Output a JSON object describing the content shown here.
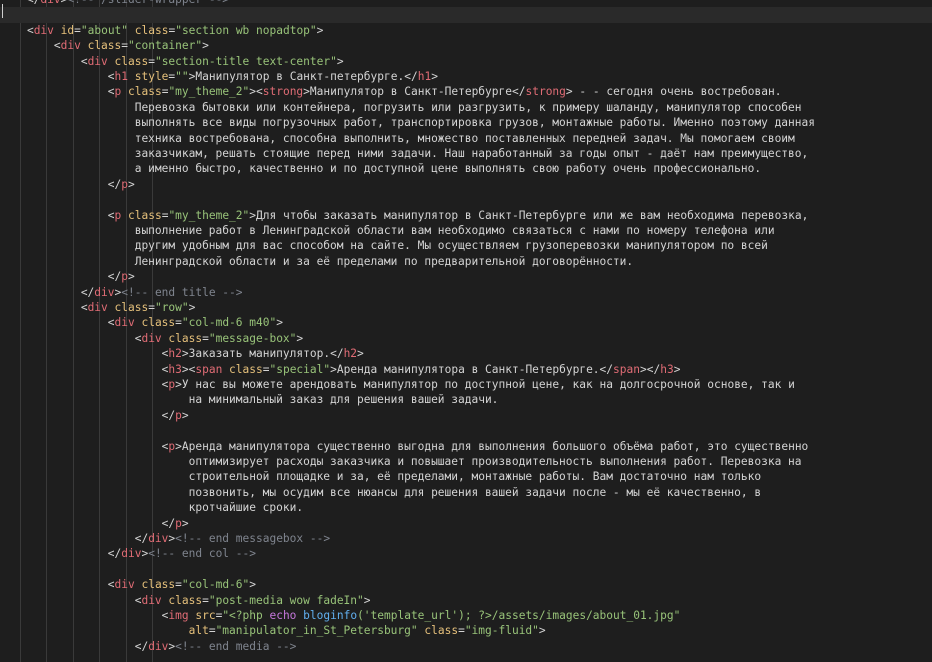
{
  "lines": [
    [
      {
        "cls": "p",
        "text": "    </"
      },
      {
        "cls": "t",
        "text": "div"
      },
      {
        "cls": "p",
        "text": ">"
      },
      {
        "cls": "c",
        "text": "<!-- /slider-wrapper -->"
      }
    ],
    [],
    [
      {
        "cls": "p",
        "text": "    <"
      },
      {
        "cls": "t",
        "text": "div"
      },
      {
        "cls": "a",
        "text": " id"
      },
      {
        "cls": "p",
        "text": "="
      },
      {
        "cls": "s",
        "text": "\"about\""
      },
      {
        "cls": "a",
        "text": " class"
      },
      {
        "cls": "p",
        "text": "="
      },
      {
        "cls": "s",
        "text": "\"section wb nopadtop\""
      },
      {
        "cls": "p",
        "text": ">"
      }
    ],
    [
      {
        "cls": "p",
        "text": "        <"
      },
      {
        "cls": "t",
        "text": "div"
      },
      {
        "cls": "a",
        "text": " class"
      },
      {
        "cls": "p",
        "text": "="
      },
      {
        "cls": "s",
        "text": "\"container\""
      },
      {
        "cls": "p",
        "text": ">"
      }
    ],
    [
      {
        "cls": "p",
        "text": "            <"
      },
      {
        "cls": "t",
        "text": "div"
      },
      {
        "cls": "a",
        "text": " class"
      },
      {
        "cls": "p",
        "text": "="
      },
      {
        "cls": "s",
        "text": "\"section-title text-center\""
      },
      {
        "cls": "p",
        "text": ">"
      }
    ],
    [
      {
        "cls": "p",
        "text": "                <"
      },
      {
        "cls": "t",
        "text": "h1"
      },
      {
        "cls": "a",
        "text": " style"
      },
      {
        "cls": "p",
        "text": "="
      },
      {
        "cls": "s",
        "text": "\"\""
      },
      {
        "cls": "p",
        "text": ">"
      },
      {
        "cls": "x",
        "text": "Манипулятор в Санкт-петербурге."
      },
      {
        "cls": "p",
        "text": "</"
      },
      {
        "cls": "t",
        "text": "h1"
      },
      {
        "cls": "p",
        "text": ">"
      }
    ],
    [
      {
        "cls": "p",
        "text": "                <"
      },
      {
        "cls": "t",
        "text": "p"
      },
      {
        "cls": "a",
        "text": " class"
      },
      {
        "cls": "p",
        "text": "="
      },
      {
        "cls": "s",
        "text": "\"my_theme_2\""
      },
      {
        "cls": "p",
        "text": "><"
      },
      {
        "cls": "t",
        "text": "strong"
      },
      {
        "cls": "p",
        "text": ">"
      },
      {
        "cls": "x",
        "text": "Манипулятор в Санкт-Петербурге"
      },
      {
        "cls": "p",
        "text": "</"
      },
      {
        "cls": "t",
        "text": "strong"
      },
      {
        "cls": "p",
        "text": ">"
      },
      {
        "cls": "x",
        "text": " - - сегодня очень востребован."
      }
    ],
    [
      {
        "cls": "x",
        "text": "                    Перевозка бытовки или контейнера, погрузить или разгрузить, к примеру шаланду, манипулятор способен"
      }
    ],
    [
      {
        "cls": "x",
        "text": "                    выполнять все виды погрузочных работ, транспортировка грузов, монтажные работы. Именно поэтому данная"
      }
    ],
    [
      {
        "cls": "x",
        "text": "                    техника востребована, способна выполнить, множество поставленных передней задач. Мы помогаем своим"
      }
    ],
    [
      {
        "cls": "x",
        "text": "                    заказчикам, решать стоящие перед ними задачи. Наш наработанный за годы опыт - даёт нам преимущество,"
      }
    ],
    [
      {
        "cls": "x",
        "text": "                    а именно быстро, качественно и по доступной цене выполнять свою работу очень профессионально."
      }
    ],
    [
      {
        "cls": "p",
        "text": "                </"
      },
      {
        "cls": "t",
        "text": "p"
      },
      {
        "cls": "p",
        "text": ">"
      }
    ],
    [],
    [
      {
        "cls": "p",
        "text": "                <"
      },
      {
        "cls": "t",
        "text": "p"
      },
      {
        "cls": "a",
        "text": " class"
      },
      {
        "cls": "p",
        "text": "="
      },
      {
        "cls": "s",
        "text": "\"my_theme_2\""
      },
      {
        "cls": "p",
        "text": ">"
      },
      {
        "cls": "x",
        "text": "Для чтобы заказать манипулятор в Санкт-Петербурге или же вам необходима перевозка,"
      }
    ],
    [
      {
        "cls": "x",
        "text": "                    выполнение работ в Ленинградской области вам необходимо связаться с нами по номеру телефона или"
      }
    ],
    [
      {
        "cls": "x",
        "text": "                    другим удобным для вас способом на сайте. Мы осуществляем грузоперевозки манипулятором по всей"
      }
    ],
    [
      {
        "cls": "x",
        "text": "                    Ленинградской области и за её пределами по предварительной договорённости."
      }
    ],
    [
      {
        "cls": "p",
        "text": "                </"
      },
      {
        "cls": "t",
        "text": "p"
      },
      {
        "cls": "p",
        "text": ">"
      }
    ],
    [
      {
        "cls": "p",
        "text": "            </"
      },
      {
        "cls": "t",
        "text": "div"
      },
      {
        "cls": "p",
        "text": ">"
      },
      {
        "cls": "c",
        "text": "<!-- end title -->"
      }
    ],
    [
      {
        "cls": "p",
        "text": "            <"
      },
      {
        "cls": "t",
        "text": "div"
      },
      {
        "cls": "a",
        "text": " class"
      },
      {
        "cls": "p",
        "text": "="
      },
      {
        "cls": "s",
        "text": "\"row\""
      },
      {
        "cls": "p",
        "text": ">"
      }
    ],
    [
      {
        "cls": "p",
        "text": "                <"
      },
      {
        "cls": "t",
        "text": "div"
      },
      {
        "cls": "a",
        "text": " class"
      },
      {
        "cls": "p",
        "text": "="
      },
      {
        "cls": "s",
        "text": "\"col-md-6 m40\""
      },
      {
        "cls": "p",
        "text": ">"
      }
    ],
    [
      {
        "cls": "p",
        "text": "                    <"
      },
      {
        "cls": "t",
        "text": "div"
      },
      {
        "cls": "a",
        "text": " class"
      },
      {
        "cls": "p",
        "text": "="
      },
      {
        "cls": "s",
        "text": "\"message-box\""
      },
      {
        "cls": "p",
        "text": ">"
      }
    ],
    [
      {
        "cls": "p",
        "text": "                        <"
      },
      {
        "cls": "t",
        "text": "h2"
      },
      {
        "cls": "p",
        "text": ">"
      },
      {
        "cls": "x",
        "text": "Заказать манипулятор."
      },
      {
        "cls": "p",
        "text": "</"
      },
      {
        "cls": "t",
        "text": "h2"
      },
      {
        "cls": "p",
        "text": ">"
      }
    ],
    [
      {
        "cls": "p",
        "text": "                        <"
      },
      {
        "cls": "t",
        "text": "h3"
      },
      {
        "cls": "p",
        "text": "><"
      },
      {
        "cls": "t",
        "text": "span"
      },
      {
        "cls": "a",
        "text": " class"
      },
      {
        "cls": "p",
        "text": "="
      },
      {
        "cls": "s",
        "text": "\"special\""
      },
      {
        "cls": "p",
        "text": ">"
      },
      {
        "cls": "x",
        "text": "Аренда манипулятора в Санкт-Петербурге."
      },
      {
        "cls": "p",
        "text": "</"
      },
      {
        "cls": "t",
        "text": "span"
      },
      {
        "cls": "p",
        "text": "></"
      },
      {
        "cls": "t",
        "text": "h3"
      },
      {
        "cls": "p",
        "text": ">"
      }
    ],
    [
      {
        "cls": "p",
        "text": "                        <"
      },
      {
        "cls": "t",
        "text": "p"
      },
      {
        "cls": "p",
        "text": ">"
      },
      {
        "cls": "x",
        "text": "У нас вы можете арендовать манипулятор по доступной цене, как на долгосрочной основе, так и"
      }
    ],
    [
      {
        "cls": "x",
        "text": "                            на минимальный заказ для решения вашей задачи."
      }
    ],
    [
      {
        "cls": "p",
        "text": "                        </"
      },
      {
        "cls": "t",
        "text": "p"
      },
      {
        "cls": "p",
        "text": ">"
      }
    ],
    [],
    [
      {
        "cls": "p",
        "text": "                        <"
      },
      {
        "cls": "t",
        "text": "p"
      },
      {
        "cls": "p",
        "text": ">"
      },
      {
        "cls": "x",
        "text": "Аренда манипулятора существенно выгодна для выполнения большого объёма работ, это существенно"
      }
    ],
    [
      {
        "cls": "x",
        "text": "                            оптимизирует расходы заказчика и повышает производительность выполнения работ. Перевозка на"
      }
    ],
    [
      {
        "cls": "x",
        "text": "                            строительной площадке и за, её пределами, монтажные работы. Вам достаточно нам только"
      }
    ],
    [
      {
        "cls": "x",
        "text": "                            позвонить, мы осудим все нюансы для решения вашей задачи после - мы её качественно, в"
      }
    ],
    [
      {
        "cls": "x",
        "text": "                            кротчайшие сроки."
      }
    ],
    [
      {
        "cls": "p",
        "text": "                        </"
      },
      {
        "cls": "t",
        "text": "p"
      },
      {
        "cls": "p",
        "text": ">"
      }
    ],
    [
      {
        "cls": "p",
        "text": "                    </"
      },
      {
        "cls": "t",
        "text": "div"
      },
      {
        "cls": "p",
        "text": ">"
      },
      {
        "cls": "c",
        "text": "<!-- end messagebox -->"
      }
    ],
    [
      {
        "cls": "p",
        "text": "                </"
      },
      {
        "cls": "t",
        "text": "div"
      },
      {
        "cls": "p",
        "text": ">"
      },
      {
        "cls": "c",
        "text": "<!-- end col -->"
      }
    ],
    [],
    [
      {
        "cls": "p",
        "text": "                <"
      },
      {
        "cls": "t",
        "text": "div"
      },
      {
        "cls": "a",
        "text": " class"
      },
      {
        "cls": "p",
        "text": "="
      },
      {
        "cls": "s",
        "text": "\"col-md-6\""
      },
      {
        "cls": "p",
        "text": ">"
      }
    ],
    [
      {
        "cls": "p",
        "text": "                    <"
      },
      {
        "cls": "t",
        "text": "div"
      },
      {
        "cls": "a",
        "text": " class"
      },
      {
        "cls": "p",
        "text": "="
      },
      {
        "cls": "s",
        "text": "\"post-media wow fadeIn\""
      },
      {
        "cls": "p",
        "text": ">"
      }
    ],
    [
      {
        "cls": "p",
        "text": "                        <"
      },
      {
        "cls": "t",
        "text": "img"
      },
      {
        "cls": "a",
        "text": " src"
      },
      {
        "cls": "p",
        "text": "="
      },
      {
        "cls": "s",
        "text": "\"<?php "
      },
      {
        "cls": "k",
        "text": "echo"
      },
      {
        "cls": "s",
        "text": " "
      },
      {
        "cls": "f",
        "text": "bloginfo"
      },
      {
        "cls": "s",
        "text": "('template_url'); ?>/assets/images/about_01.jpg\""
      }
    ],
    [
      {
        "cls": "a",
        "text": "                            alt"
      },
      {
        "cls": "p",
        "text": "="
      },
      {
        "cls": "s",
        "text": "\"manipulator_in_St_Petersburg\""
      },
      {
        "cls": "a",
        "text": " class"
      },
      {
        "cls": "p",
        "text": "="
      },
      {
        "cls": "s",
        "text": "\"img-fluid\""
      },
      {
        "cls": "p",
        "text": ">"
      }
    ],
    [
      {
        "cls": "p",
        "text": "                    </"
      },
      {
        "cls": "t",
        "text": "div"
      },
      {
        "cls": "p",
        "text": ">"
      },
      {
        "cls": "c",
        "text": "<!-- end media -->"
      }
    ]
  ]
}
